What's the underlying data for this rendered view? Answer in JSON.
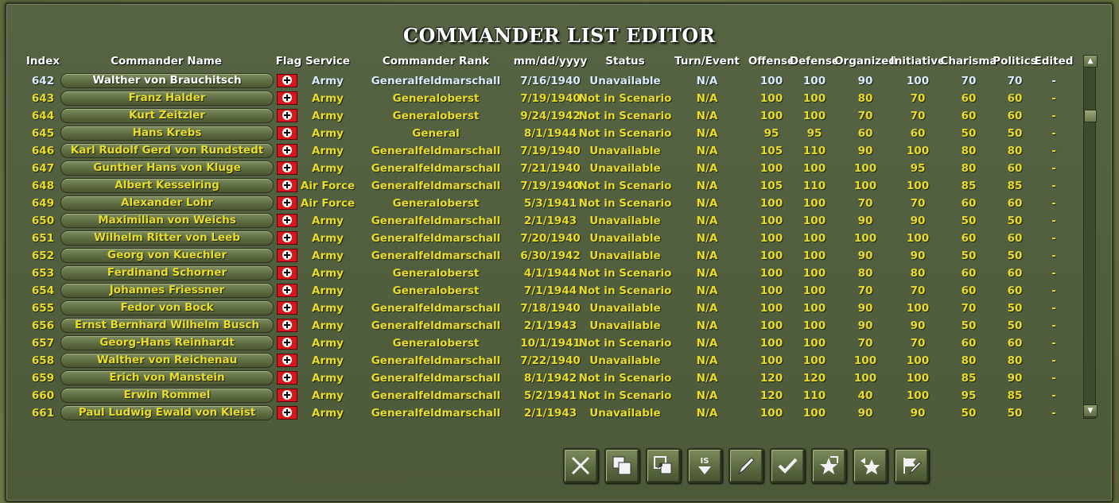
{
  "title": "COMMANDER LIST EDITOR",
  "columns": {
    "index": "Index",
    "name": "Commander Name",
    "flag": "Flag",
    "service": "Service",
    "rank": "Commander Rank",
    "date": "mm/dd/yyyy",
    "status": "Status",
    "turn": "Turn/Event",
    "offense": "Offense",
    "defense": "Defense",
    "organized": "Organized",
    "initiative": "Initiative",
    "charisma": "Charisma",
    "politics": "Politics",
    "edited": "Edited"
  },
  "rows": [
    {
      "index": "642",
      "name": "Walther von Brauchitsch",
      "service": "Army",
      "rank": "Generalfeldmarschall",
      "date": "7/16/1940",
      "status": "Unavailable",
      "turn": "N/A",
      "offense": "100",
      "defense": "100",
      "organized": "90",
      "initiative": "100",
      "charisma": "70",
      "politics": "70",
      "edited": "-"
    },
    {
      "index": "643",
      "name": "Franz Halder",
      "service": "Army",
      "rank": "Generaloberst",
      "date": "7/19/1940",
      "status": "Not in Scenario",
      "turn": "N/A",
      "offense": "100",
      "defense": "100",
      "organized": "80",
      "initiative": "70",
      "charisma": "60",
      "politics": "60",
      "edited": "-"
    },
    {
      "index": "644",
      "name": "Kurt Zeitzler",
      "service": "Army",
      "rank": "Generaloberst",
      "date": "9/24/1942",
      "status": "Not in Scenario",
      "turn": "N/A",
      "offense": "100",
      "defense": "100",
      "organized": "70",
      "initiative": "70",
      "charisma": "60",
      "politics": "60",
      "edited": "-"
    },
    {
      "index": "645",
      "name": "Hans Krebs",
      "service": "Army",
      "rank": "General",
      "date": "8/1/1944",
      "status": "Not in Scenario",
      "turn": "N/A",
      "offense": "95",
      "defense": "95",
      "organized": "60",
      "initiative": "60",
      "charisma": "50",
      "politics": "50",
      "edited": "-"
    },
    {
      "index": "646",
      "name": "Karl Rudolf Gerd von Rundstedt",
      "service": "Army",
      "rank": "Generalfeldmarschall",
      "date": "7/19/1940",
      "status": "Unavailable",
      "turn": "N/A",
      "offense": "105",
      "defense": "110",
      "organized": "90",
      "initiative": "100",
      "charisma": "80",
      "politics": "80",
      "edited": "-"
    },
    {
      "index": "647",
      "name": "Gunther Hans von Kluge",
      "service": "Army",
      "rank": "Generalfeldmarschall",
      "date": "7/21/1940",
      "status": "Unavailable",
      "turn": "N/A",
      "offense": "100",
      "defense": "100",
      "organized": "100",
      "initiative": "95",
      "charisma": "80",
      "politics": "60",
      "edited": "-"
    },
    {
      "index": "648",
      "name": "Albert Kesselring",
      "service": "Air Force",
      "rank": "Generalfeldmarschall",
      "date": "7/19/1940",
      "status": "Not in Scenario",
      "turn": "N/A",
      "offense": "105",
      "defense": "110",
      "organized": "100",
      "initiative": "100",
      "charisma": "85",
      "politics": "85",
      "edited": "-"
    },
    {
      "index": "649",
      "name": "Alexander Lohr",
      "service": "Air Force",
      "rank": "Generaloberst",
      "date": "5/3/1941",
      "status": "Not in Scenario",
      "turn": "N/A",
      "offense": "100",
      "defense": "100",
      "organized": "70",
      "initiative": "70",
      "charisma": "60",
      "politics": "60",
      "edited": "-"
    },
    {
      "index": "650",
      "name": "Maximilian von Weichs",
      "service": "Army",
      "rank": "Generalfeldmarschall",
      "date": "2/1/1943",
      "status": "Unavailable",
      "turn": "N/A",
      "offense": "100",
      "defense": "100",
      "organized": "90",
      "initiative": "90",
      "charisma": "50",
      "politics": "50",
      "edited": "-"
    },
    {
      "index": "651",
      "name": "Wilhelm Ritter von Leeb",
      "service": "Army",
      "rank": "Generalfeldmarschall",
      "date": "7/20/1940",
      "status": "Unavailable",
      "turn": "N/A",
      "offense": "100",
      "defense": "100",
      "organized": "100",
      "initiative": "100",
      "charisma": "60",
      "politics": "60",
      "edited": "-"
    },
    {
      "index": "652",
      "name": "Georg von Kuechler",
      "service": "Army",
      "rank": "Generalfeldmarschall",
      "date": "6/30/1942",
      "status": "Unavailable",
      "turn": "N/A",
      "offense": "100",
      "defense": "100",
      "organized": "90",
      "initiative": "90",
      "charisma": "50",
      "politics": "50",
      "edited": "-"
    },
    {
      "index": "653",
      "name": "Ferdinand Schorner",
      "service": "Army",
      "rank": "Generaloberst",
      "date": "4/1/1944",
      "status": "Not in Scenario",
      "turn": "N/A",
      "offense": "100",
      "defense": "100",
      "organized": "80",
      "initiative": "80",
      "charisma": "60",
      "politics": "60",
      "edited": "-"
    },
    {
      "index": "654",
      "name": "Johannes Friessner",
      "service": "Army",
      "rank": "Generaloberst",
      "date": "7/1/1944",
      "status": "Not in Scenario",
      "turn": "N/A",
      "offense": "100",
      "defense": "100",
      "organized": "70",
      "initiative": "70",
      "charisma": "60",
      "politics": "60",
      "edited": "-"
    },
    {
      "index": "655",
      "name": "Fedor von Bock",
      "service": "Army",
      "rank": "Generalfeldmarschall",
      "date": "7/18/1940",
      "status": "Unavailable",
      "turn": "N/A",
      "offense": "100",
      "defense": "100",
      "organized": "90",
      "initiative": "100",
      "charisma": "70",
      "politics": "50",
      "edited": "-"
    },
    {
      "index": "656",
      "name": "Ernst Bernhard Wilhelm Busch",
      "service": "Army",
      "rank": "Generalfeldmarschall",
      "date": "2/1/1943",
      "status": "Unavailable",
      "turn": "N/A",
      "offense": "100",
      "defense": "100",
      "organized": "90",
      "initiative": "90",
      "charisma": "50",
      "politics": "50",
      "edited": "-"
    },
    {
      "index": "657",
      "name": "Georg-Hans Reinhardt",
      "service": "Army",
      "rank": "Generaloberst",
      "date": "10/1/1941",
      "status": "Not in Scenario",
      "turn": "N/A",
      "offense": "100",
      "defense": "100",
      "organized": "70",
      "initiative": "70",
      "charisma": "60",
      "politics": "60",
      "edited": "-"
    },
    {
      "index": "658",
      "name": "Walther von Reichenau",
      "service": "Army",
      "rank": "Generalfeldmarschall",
      "date": "7/22/1940",
      "status": "Unavailable",
      "turn": "N/A",
      "offense": "100",
      "defense": "100",
      "organized": "100",
      "initiative": "100",
      "charisma": "80",
      "politics": "80",
      "edited": "-"
    },
    {
      "index": "659",
      "name": "Erich von Manstein",
      "service": "Army",
      "rank": "Generalfeldmarschall",
      "date": "8/1/1942",
      "status": "Not in Scenario",
      "turn": "N/A",
      "offense": "120",
      "defense": "120",
      "organized": "100",
      "initiative": "100",
      "charisma": "85",
      "politics": "90",
      "edited": "-"
    },
    {
      "index": "660",
      "name": "Erwin Rommel",
      "service": "Army",
      "rank": "Generalfeldmarschall",
      "date": "5/2/1941",
      "status": "Not in Scenario",
      "turn": "N/A",
      "offense": "120",
      "defense": "110",
      "organized": "40",
      "initiative": "100",
      "charisma": "95",
      "politics": "85",
      "edited": "-"
    },
    {
      "index": "661",
      "name": "Paul Ludwig Ewald von Kleist",
      "service": "Army",
      "rank": "Generalfeldmarschall",
      "date": "2/1/1943",
      "status": "Unavailable",
      "turn": "N/A",
      "offense": "100",
      "defense": "100",
      "organized": "90",
      "initiative": "90",
      "charisma": "50",
      "politics": "50",
      "edited": "-"
    }
  ],
  "selected_row": "642",
  "toolbar": [
    {
      "name": "delete-button",
      "icon": "x-icon"
    },
    {
      "name": "copy-button",
      "icon": "copy-icon"
    },
    {
      "name": "paste-button",
      "icon": "paste-icon"
    },
    {
      "name": "sort-button",
      "icon": "sort-down-icon",
      "text": "IS"
    },
    {
      "name": "edit-button",
      "icon": "pen-icon"
    },
    {
      "name": "accept-button",
      "icon": "checkmark-icon"
    },
    {
      "name": "promote-button",
      "icon": "star-arrow-icon"
    },
    {
      "name": "demote-button",
      "icon": "star-left-icon"
    },
    {
      "name": "flag-edit-button",
      "icon": "flag-pen-icon"
    }
  ],
  "colors": {
    "text_yellow": "#e9dd2a",
    "text_selected": "#d9ecff",
    "panel": "#4f5c3c",
    "flag_red": "#d8171b"
  }
}
